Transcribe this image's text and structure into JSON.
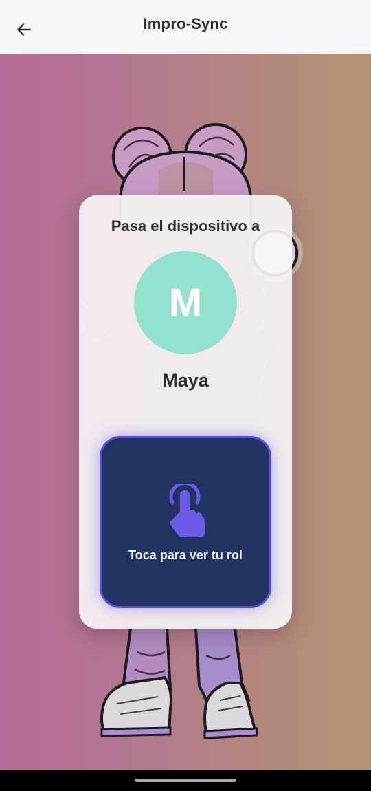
{
  "header": {
    "title": "Impro-Sync",
    "back_icon": "arrow-back-icon"
  },
  "card": {
    "pass_label": "Pasa el dispositivo a",
    "avatar_letter": "M",
    "avatar_color": "#95e1cf",
    "player_name": "Maya",
    "reveal_label": "Toca para ver tu rol",
    "reveal_icon": "tap-finger-icon",
    "reveal_bg": "#213461",
    "accent": "#6b5be6"
  }
}
